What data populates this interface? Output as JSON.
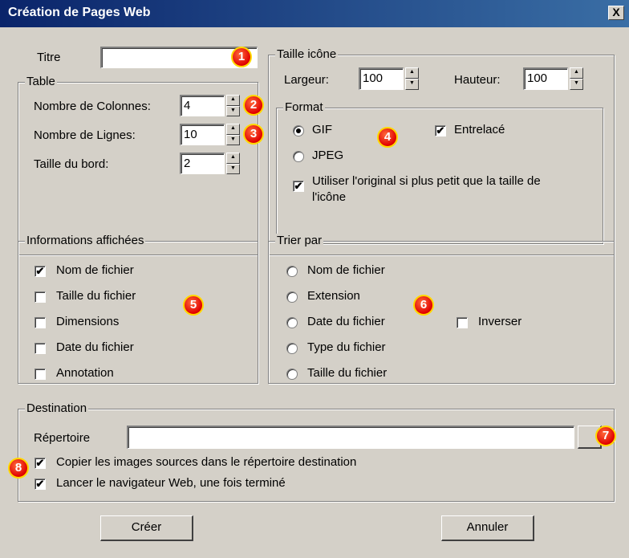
{
  "window": {
    "title": "Création de Pages Web",
    "close_symbol": "X"
  },
  "titre": {
    "label": "Titre",
    "value": ""
  },
  "table": {
    "legend": "Table",
    "colonnes": {
      "label": "Nombre de Colonnes:",
      "value": "4"
    },
    "lignes": {
      "label": "Nombre de Lignes:",
      "value": "10"
    },
    "bord": {
      "label": "Taille du bord:",
      "value": "2"
    }
  },
  "icone": {
    "legend": "Taille icône",
    "largeur": {
      "label": "Largeur:",
      "value": "100"
    },
    "hauteur": {
      "label": "Hauteur:",
      "value": "100"
    }
  },
  "format": {
    "legend": "Format",
    "gif": "GIF",
    "jpeg": "JPEG",
    "entrelace": "Entrelacé",
    "original_1": "Utiliser l'original si plus petit que la taille de",
    "original_2": "l'icône"
  },
  "infos": {
    "legend": "Informations affichées",
    "items": [
      "Nom de fichier",
      "Taille du fichier",
      "Dimensions",
      "Date du fichier",
      "Annotation"
    ]
  },
  "trier": {
    "legend": "Trier par",
    "items": [
      "Nom de fichier",
      "Extension",
      "Date du fichier",
      "Type du fichier",
      "Taille du fichier"
    ],
    "inverser": "Inverser"
  },
  "destination": {
    "legend": "Destination",
    "repertoire_label": "Répertoire",
    "repertoire_value": "",
    "copier": "Copier les images sources dans le répertoire destination",
    "lancer": "Lancer le navigateur Web, une fois terminé"
  },
  "buttons": {
    "creer": "Créer",
    "annuler": "Annuler"
  },
  "spin": {
    "up": "▲",
    "down": "▼"
  },
  "check_mark": "✔",
  "badges": [
    "1",
    "2",
    "3",
    "4",
    "5",
    "6",
    "7",
    "8"
  ]
}
